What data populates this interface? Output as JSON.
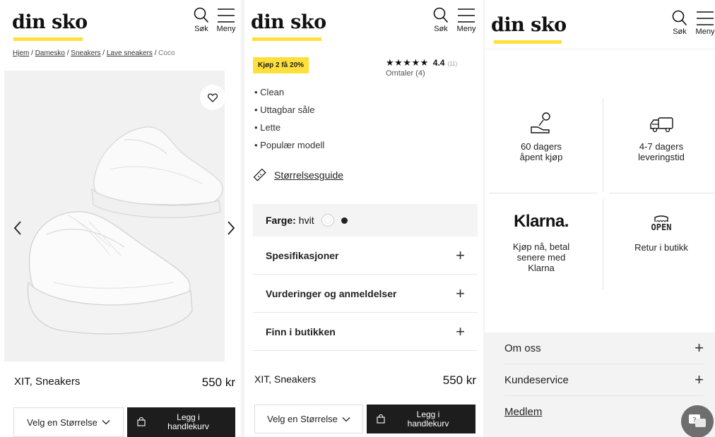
{
  "brand": {
    "logo_text": "din sko",
    "accent_color": "#ffe03a"
  },
  "header": {
    "search_label": "Søk",
    "menu_label": "Meny",
    "search_icon": "search-icon",
    "menu_icon": "hamburger-icon"
  },
  "breadcrumb": {
    "items": [
      "Hjem",
      "Damesko",
      "Sneakers",
      "Lave sneakers"
    ],
    "current": "Coco",
    "separator": "/"
  },
  "product": {
    "name": "XIT, Sneakers",
    "price": "550 kr",
    "image_alt": "white chunky sneakers",
    "favorite_icon": "heart-icon",
    "size_select": "Velg en Størrelse",
    "add_to_cart_line1": "Legg i",
    "add_to_cart_line2": "handlekurv"
  },
  "details": {
    "badge": "Kjøp 2 få 20%",
    "rating": {
      "stars": "★★★★★",
      "score": "4.4",
      "count": "(11)",
      "reviews_label": "Omtaler (4)"
    },
    "features": [
      "Clean",
      "Uttagbar såle",
      "Lette",
      "Populær modell"
    ],
    "size_guide": "Størrelsesguide",
    "color_label": "Farge:",
    "color_value": "hvit",
    "accordions": [
      "Spesifikasjoner",
      "Vurderinger og anmeldelser",
      "Finn i butikken"
    ]
  },
  "usps": {
    "open_purchase": {
      "line1": "60 dagers",
      "line2": "åpent kjøp"
    },
    "delivery": {
      "line1": "4-7 dagers",
      "line2": "leveringstid"
    },
    "klarna": {
      "logo": "Klarna.",
      "line1": "Kjøp nå, betal",
      "line2": "senere med",
      "line3": "Klarna"
    },
    "return": {
      "sign": "OPEN",
      "text": "Retur i butikk"
    }
  },
  "footer": {
    "items": [
      "Om oss",
      "Kundeservice",
      "Medlem"
    ]
  },
  "chat": {
    "icon": "chat-icon",
    "glyph": "?"
  }
}
